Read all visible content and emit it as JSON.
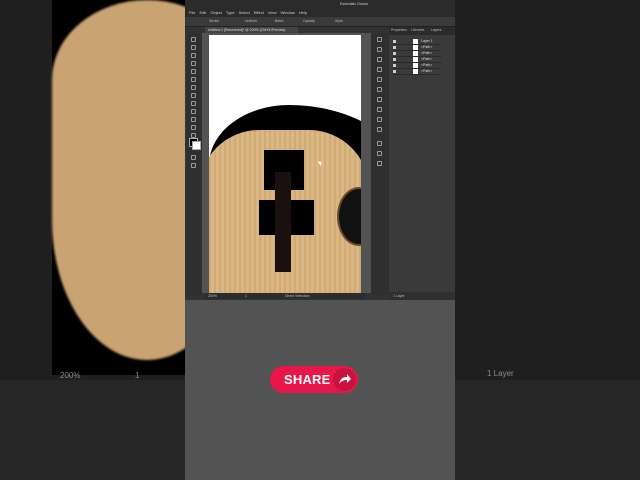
{
  "app": {
    "menu": [
      "File",
      "Edit",
      "Object",
      "Type",
      "Select",
      "Effect",
      "View",
      "Window",
      "Help"
    ],
    "workspace": "Essentials Classic",
    "doc_tab": "Untitled-1 [Recovered]* @ 200% (CMYK/Preview)",
    "control_labels": [
      "Stroke",
      "Uniform",
      "Basic",
      "Opacity",
      "Style"
    ],
    "status_zoom": "200%",
    "status_page": "1",
    "status_tool": "Direct Selection"
  },
  "panels": {
    "tabs": [
      "Properties",
      "Libraries",
      "Layers"
    ],
    "layers": [
      "Layer 1",
      "<Path>",
      "<Path>",
      "<Path>",
      "<Path>",
      "<Path>"
    ],
    "footer": "1 Layer"
  },
  "background": {
    "left_zoom": "200%",
    "left_page": "1",
    "right_footer": "1 Layer"
  },
  "share": {
    "label": "SHARE",
    "icon": "share-arrow-icon",
    "color": "#e8174a"
  }
}
